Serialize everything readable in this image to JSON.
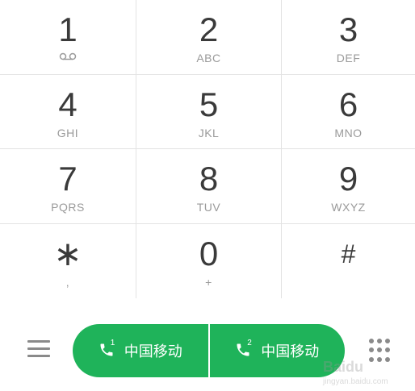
{
  "keypad": [
    {
      "digit": "1",
      "sub": "",
      "icon": "voicemail-icon"
    },
    {
      "digit": "2",
      "sub": "ABC"
    },
    {
      "digit": "3",
      "sub": "DEF"
    },
    {
      "digit": "4",
      "sub": "GHI"
    },
    {
      "digit": "5",
      "sub": "JKL"
    },
    {
      "digit": "6",
      "sub": "MNO"
    },
    {
      "digit": "7",
      "sub": "PQRS"
    },
    {
      "digit": "8",
      "sub": "TUV"
    },
    {
      "digit": "9",
      "sub": "WXYZ"
    },
    {
      "digit": "∗",
      "sub": ","
    },
    {
      "digit": "0",
      "sub": "+"
    },
    {
      "digit": "#",
      "sub": ""
    }
  ],
  "call_buttons": [
    {
      "sim": "1",
      "label": "中国移动"
    },
    {
      "sim": "2",
      "label": "中国移动"
    }
  ],
  "watermark": {
    "text": "Baidu",
    "sub": "jingyan.baidu.com"
  },
  "colors": {
    "call_green": "#1fb35a",
    "digit_text": "#3a3a3a",
    "sub_text": "#9a9a9a",
    "divider": "#e3e3e3"
  }
}
